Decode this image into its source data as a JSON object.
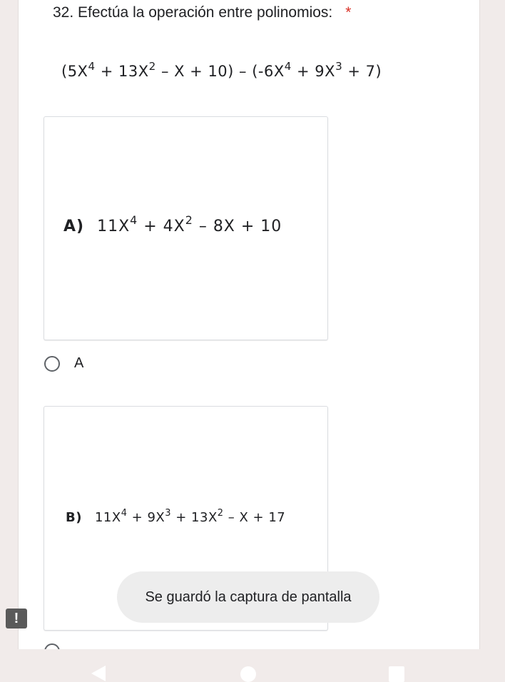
{
  "question": {
    "number_title": "32. Efectúa la operación entre polinomios:",
    "required_mark": "*",
    "formula": {
      "open1": "(5X",
      "exp1": "4",
      "t1": " + 13X",
      "exp2": "2",
      "t2": " – X + 10) – (-6X",
      "exp3": "4",
      "t3": " + 9X",
      "exp4": "3",
      "t4": " + 7)"
    }
  },
  "option_a": {
    "letter": "A)",
    "p1": "11X",
    "e1": "4",
    "p2": " + 4X",
    "e2": "2",
    "p3": " – 8X + 10",
    "radio_label": "A"
  },
  "option_b": {
    "letter": "B)",
    "p1": "11X",
    "e1": "4",
    "p2": " + 9X",
    "e2": "3",
    "p3": " + 13X",
    "e3": "2",
    "p4": " – X + 17"
  },
  "toast": {
    "text": "Se guardó la captura de pantalla"
  },
  "alert_badge": {
    "text": "!"
  },
  "colors": {
    "required": "#d93025",
    "background": "#f1ebea"
  }
}
